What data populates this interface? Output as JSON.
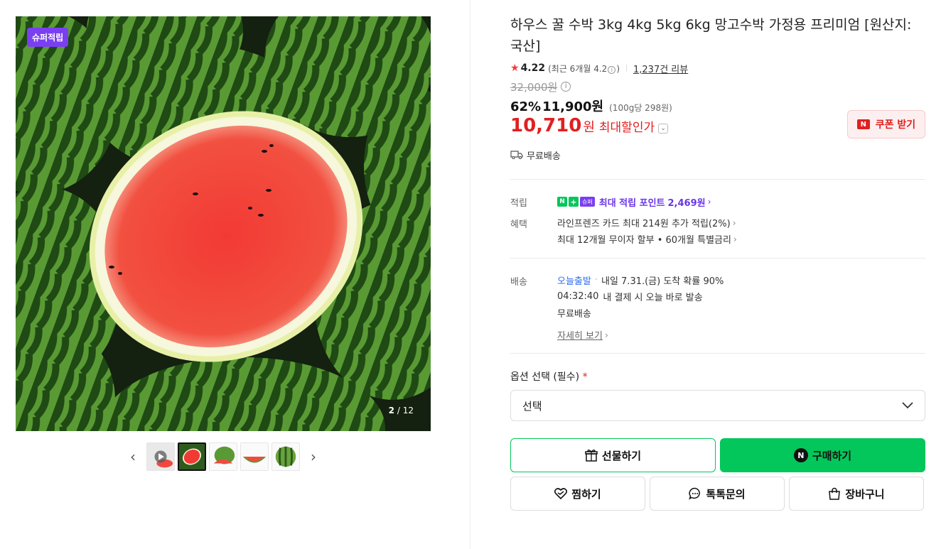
{
  "gallery": {
    "badge": "슈퍼적립",
    "counter_current": "2",
    "counter_total": "/ 12",
    "prev_label": "‹",
    "next_label": "›"
  },
  "product": {
    "title": "하우스 꿀 수박 3kg 4kg 5kg 6kg 망고수박 가정용 프리미엄 [원산지: 국산]",
    "rating": "4.22",
    "recent_rating": "(최근 6개월 4.2",
    "recent_rating_close": ")",
    "review_count": "1,237건 리뷰",
    "original_price": "32,000원",
    "discount_pct": "62%",
    "sale_price": "11,900원",
    "unit_price": "(100g당 298원)",
    "max_discount_price": "10,710",
    "max_discount_won": "원",
    "max_discount_label": "최대할인가",
    "coupon_button": "쿠폰 받기",
    "shipping": "무료배송"
  },
  "benefits": {
    "points_label": "적립",
    "super_badge": "슈퍼",
    "points_text": "최대 적립 포인트",
    "points_value": "2,469원",
    "perks_label": "혜택",
    "perk_1": "라인프렌즈 카드 최대 214원 추가 적립(2%)",
    "perk_2": "최대 12개월 무이자 할부 • 60개월 특별금리"
  },
  "delivery": {
    "label": "배송",
    "today": "오늘출발",
    "arrival": "내일 7.31.(금) 도착 확률 90%",
    "countdown": "04:32:40",
    "countdown_text": "내 결제 시 오늘 바로 발송",
    "free": "무료배송",
    "detail_link": "자세히 보기"
  },
  "options": {
    "label": "옵션 선택 (필수)",
    "required_mark": "*",
    "select_value": "선택"
  },
  "actions": {
    "gift": "선물하기",
    "buy": "구매하기",
    "wish": "찜하기",
    "talk": "톡톡문의",
    "cart": "장바구니"
  },
  "colors": {
    "accent_green": "#03c75a",
    "price_red": "#e02020",
    "super_purple": "#7b3ff2"
  }
}
